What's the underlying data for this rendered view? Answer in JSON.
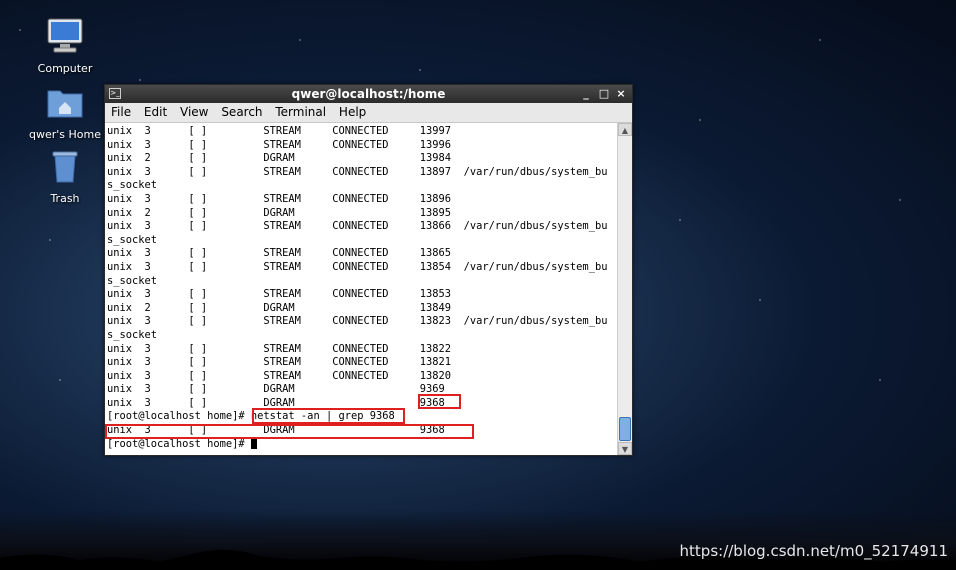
{
  "desktop": {
    "icons": [
      {
        "label": "Computer",
        "icon": "computer-icon"
      },
      {
        "label": "qwer's Home",
        "icon": "home-folder-icon"
      },
      {
        "label": "Trash",
        "icon": "trash-icon"
      }
    ],
    "watermark": "https://blog.csdn.net/m0_52174911"
  },
  "window": {
    "title": "qwer@localhost:/home",
    "controls": {
      "minimize": "_",
      "maximize": "□",
      "close": "×"
    },
    "menu": [
      "File",
      "Edit",
      "View",
      "Search",
      "Terminal",
      "Help"
    ]
  },
  "terminal": {
    "lines": [
      "unix  3      [ ]         STREAM     CONNECTED     13997",
      "unix  3      [ ]         STREAM     CONNECTED     13996",
      "unix  2      [ ]         DGRAM                    13984",
      "unix  3      [ ]         STREAM     CONNECTED     13897  /var/run/dbus/system_bu",
      "s_socket",
      "unix  3      [ ]         STREAM     CONNECTED     13896",
      "unix  2      [ ]         DGRAM                    13895",
      "unix  3      [ ]         STREAM     CONNECTED     13866  /var/run/dbus/system_bu",
      "s_socket",
      "unix  3      [ ]         STREAM     CONNECTED     13865",
      "unix  3      [ ]         STREAM     CONNECTED     13854  /var/run/dbus/system_bu",
      "s_socket",
      "unix  3      [ ]         STREAM     CONNECTED     13853",
      "unix  2      [ ]         DGRAM                    13849",
      "unix  3      [ ]         STREAM     CONNECTED     13823  /var/run/dbus/system_bu",
      "s_socket",
      "unix  3      [ ]         STREAM     CONNECTED     13822",
      "unix  3      [ ]         STREAM     CONNECTED     13821",
      "unix  3      [ ]         STREAM     CONNECTED     13820",
      "unix  3      [ ]         DGRAM                    9369",
      "unix  3      [ ]         DGRAM                    9368",
      "[root@localhost home]# netstat -an | grep 9368",
      "unix  3      [ ]         DGRAM                    9368",
      "[root@localhost home]# "
    ]
  },
  "colors": {
    "highlight": "#e02020",
    "scroll_thumb": "#7eb0e8"
  }
}
